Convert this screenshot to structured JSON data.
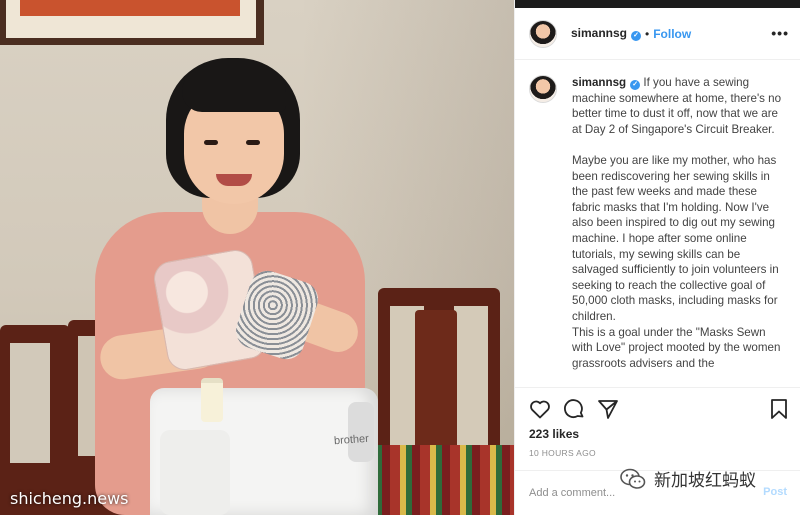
{
  "post": {
    "username": "simannsg",
    "follow_label": "Follow",
    "more_label": "•••",
    "caption": "If you have a sewing machine somewhere at home, there's no better time to dust it off, now that we are at Day 2 of Singapore's Circuit Breaker.\n\nMaybe you are like my mother, who has been rediscovering her sewing skills in the past few weeks and made these fabric masks that I'm holding. Now I've also been inspired to dig out my sewing machine. I hope after some online tutorials, my sewing skills can be salvaged sufficiently to join volunteers in seeking to reach the collective goal of 50,000 cloth masks, including masks for children.\nThis is a goal under the \"Masks Sewn with Love\" project mooted by the women grassroots advisers and the",
    "likes": "223 likes",
    "timestamp": "10 HOURS AGO",
    "comment_placeholder": "Add a comment...",
    "post_label": "Post"
  },
  "photo": {
    "machine_brand": "brother"
  },
  "watermarks": {
    "left": "shicheng.news",
    "right": "新加坡红蚂蚁"
  },
  "icons": {
    "verified": "verified-badge-icon",
    "like": "heart-icon",
    "comment": "comment-icon",
    "share": "paper-plane-icon",
    "save": "bookmark-icon",
    "watermark": "wechat-icon"
  },
  "colors": {
    "accent": "#3897f0",
    "post_button": "#b3dbff",
    "text": "#262626",
    "muted": "#8e8e8e"
  }
}
